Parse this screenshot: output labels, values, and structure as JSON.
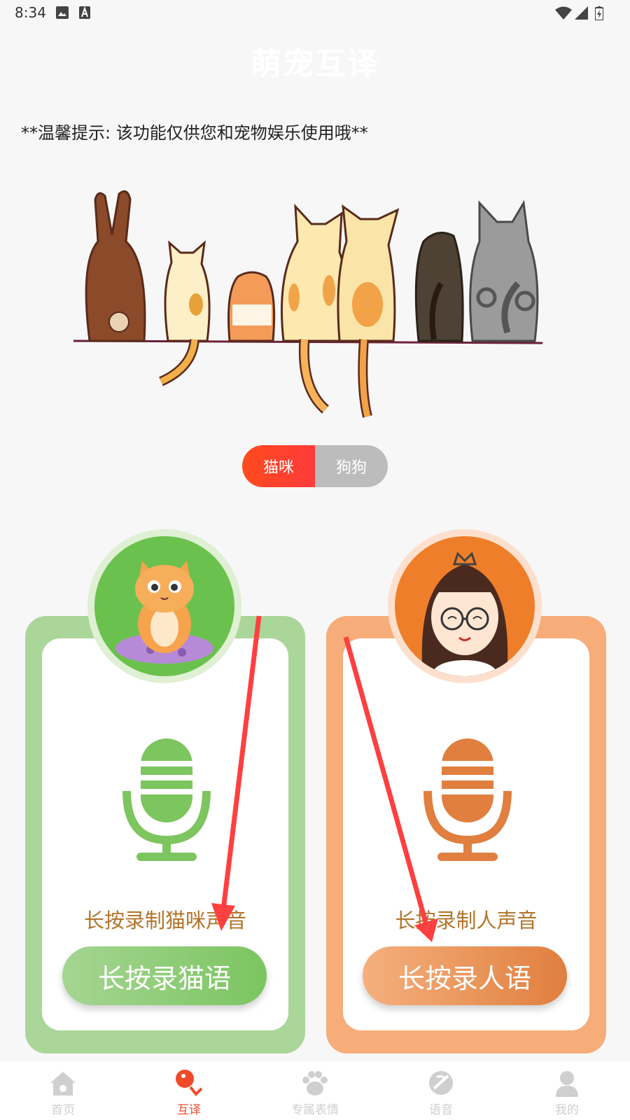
{
  "status_bar": {
    "time": "8:34"
  },
  "header": {
    "title": "萌宠互译"
  },
  "tip": "**温馨提示: 该功能仅供您和宠物娱乐使用哦**",
  "toggle": {
    "options": [
      "猫咪",
      "狗狗"
    ],
    "selected": "猫咪"
  },
  "cards": {
    "cat": {
      "label": "长按录制猫咪声音",
      "button": "长按录猫语"
    },
    "human": {
      "label": "长按录制人声音",
      "button": "长按录人语"
    }
  },
  "tabbar": {
    "items": [
      {
        "label": "首页",
        "icon": "home-icon"
      },
      {
        "label": "互译",
        "icon": "translate-icon"
      },
      {
        "label": "专属表情",
        "icon": "paw-icon"
      },
      {
        "label": "语音",
        "icon": "voice-icon"
      },
      {
        "label": "我的",
        "icon": "profile-icon"
      }
    ],
    "active": "互译"
  },
  "colors": {
    "accent": "#f04a2a",
    "cat_green": "#7bc560",
    "human_orange": "#e07f3f",
    "label_brown": "#b2742a"
  }
}
